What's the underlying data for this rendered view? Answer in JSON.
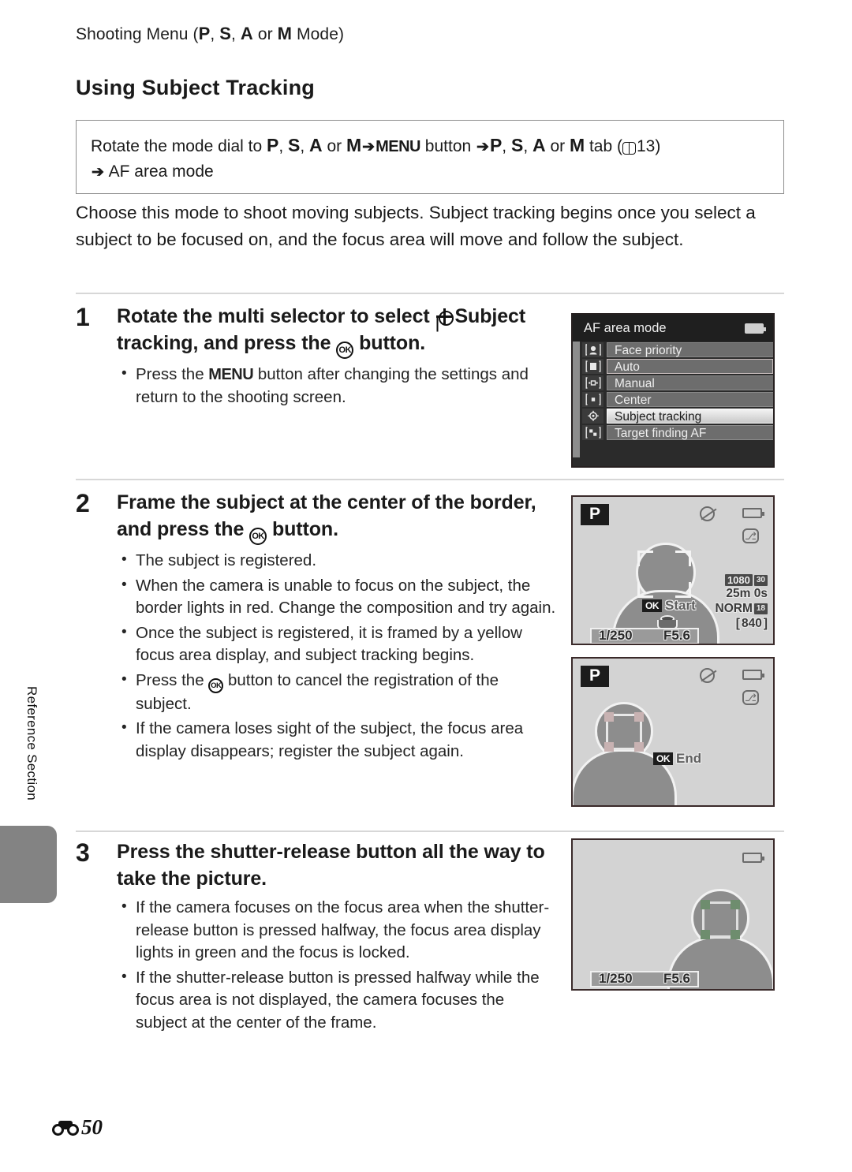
{
  "running_head": {
    "prefix": "Shooting Menu (",
    "modes": [
      "P",
      "S",
      "A",
      "M"
    ],
    "separator": ", ",
    "or_word": " or ",
    "suffix": " Mode)"
  },
  "section_title": "Using Subject Tracking",
  "nav_box": {
    "line1_a": "Rotate the mode dial to ",
    "line1_modes1": [
      "P",
      "S",
      "A",
      "M"
    ],
    "menu_button_label": "MENU",
    "button_word": " button ",
    "tab_word": " tab (",
    "page_ref": "13",
    "close_paren": ")",
    "line2": "AF area mode",
    "arrow": "➔"
  },
  "intro": "Choose this mode to shoot moving subjects. Subject tracking begins once you select a subject to be focused on, and the focus area will move and follow the subject.",
  "steps": [
    {
      "number": "1",
      "heading_part1": "Rotate the multi selector to select ",
      "heading_bold": "Subject tracking",
      "heading_part2": ", and press the ",
      "heading_part3": " button.",
      "bullets": [
        {
          "pre": "Press the ",
          "kbd": "MENU",
          "post": " button after changing the settings and return to the shooting screen."
        }
      ]
    },
    {
      "number": "2",
      "heading_part1": "Frame the subject at the center of the border, and press the ",
      "heading_part3": " button.",
      "bullets": [
        {
          "text": "The subject is registered."
        },
        {
          "text": "When the camera is unable to focus on the subject, the border lights in red. Change the composition and try again."
        },
        {
          "text": "Once the subject is registered, it is framed by a yellow focus area display, and subject tracking begins."
        },
        {
          "pre": "Press the ",
          "post": " button to cancel the registration of the subject."
        },
        {
          "text": "If the camera loses sight of the subject, the focus area display disappears; register the subject again."
        }
      ]
    },
    {
      "number": "3",
      "heading_part1": "Press the shutter-release button all the way to take the picture.",
      "bullets": [
        {
          "text": "If the camera focuses on the focus area when the shutter-release button is pressed halfway, the focus area display lights in green and the focus is locked."
        },
        {
          "text": "If the shutter-release button is pressed halfway while the focus area is not displayed, the camera focuses the subject at the center of the frame."
        }
      ]
    }
  ],
  "af_menu": {
    "title": "AF area mode",
    "items": [
      {
        "label": "Face priority",
        "icon": "face-priority-icon",
        "state": "normal"
      },
      {
        "label": "Auto",
        "icon": "auto-area-icon",
        "state": "cursor"
      },
      {
        "label": "Manual",
        "icon": "manual-area-icon",
        "state": "normal"
      },
      {
        "label": "Center",
        "icon": "center-area-icon",
        "state": "normal"
      },
      {
        "label": "Subject tracking",
        "icon": "subject-tracking-icon",
        "state": "selected"
      },
      {
        "label": "Target finding AF",
        "icon": "target-finding-icon",
        "state": "normal"
      }
    ]
  },
  "lcd_screens": [
    {
      "id": "frame-subject",
      "mode_badge": "P",
      "ok_hint_key": "OK",
      "ok_hint_label": "Start",
      "shutter_speed": "1/250",
      "aperture": "F5.6",
      "movie_size": "1080",
      "movie_fps": "30",
      "movie_fps_sup": "p",
      "record_time": "25m 0s",
      "image_quality": "NORM",
      "image_size": "18",
      "image_size_unit": "M",
      "shots_remaining": "840",
      "shots_left_bracket": "[",
      "shots_right_bracket": "]"
    },
    {
      "id": "subject-registered",
      "mode_badge": "P",
      "ok_hint_key": "OK",
      "ok_hint_label": "End"
    },
    {
      "id": "focus-locked",
      "shutter_speed": "1/250",
      "aperture": "F5.6"
    }
  ],
  "side_tab": "Reference Section",
  "footer": {
    "page_number": "50"
  },
  "colors": {
    "menu_bg": "#2b2b2b",
    "menu_title_bg": "#1f1f1f",
    "menu_row_bg": "#6d6d6d",
    "menu_selected_bg": "#f0f0f0",
    "lcd_bg": "#d3d3d3",
    "silhouette": "#8d8d8d",
    "tab_gray": "#838383",
    "divider": "#d7d7d7",
    "box_border": "#8d8d8d"
  }
}
